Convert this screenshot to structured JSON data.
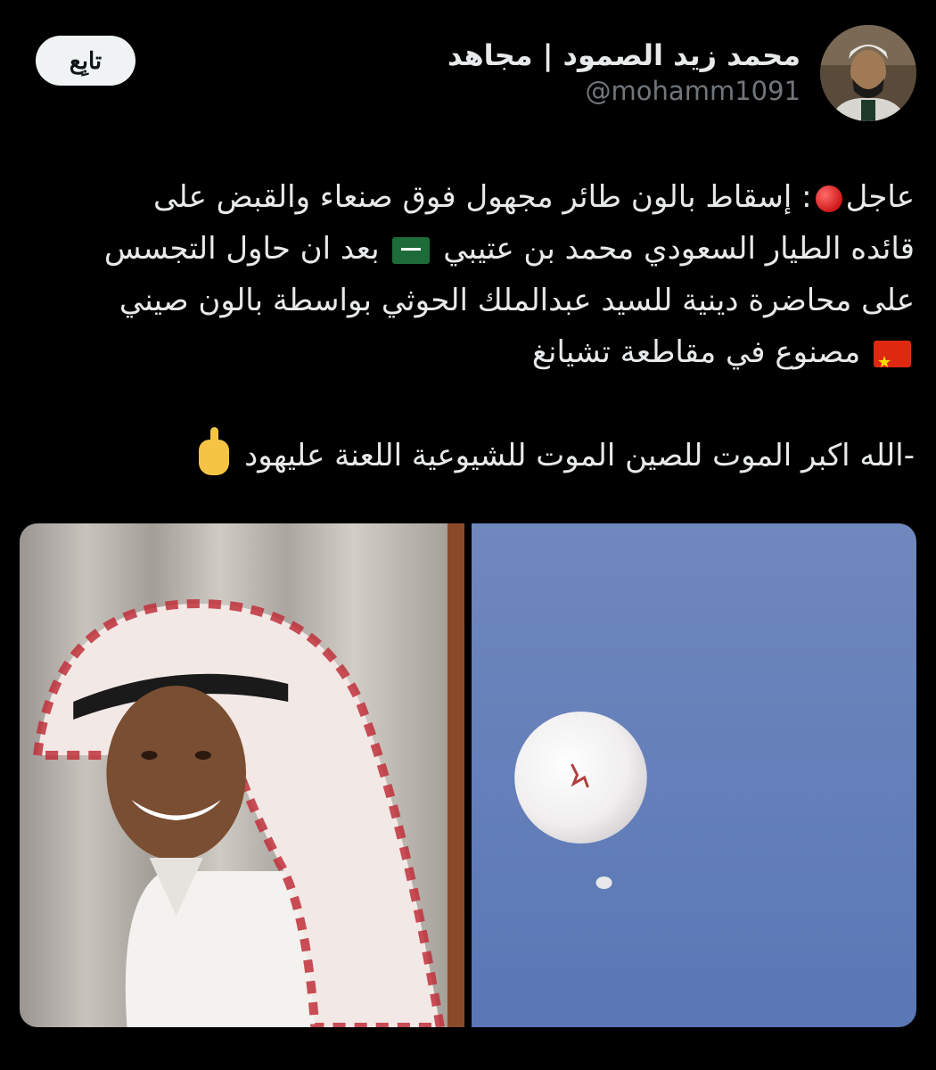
{
  "author": {
    "display_name": "محمد زيد الصمود | مجاهد",
    "handle": "@mohamm1091"
  },
  "follow_button": {
    "label": "تابِع"
  },
  "tweet": {
    "line1_before_icon": "عاجل",
    "line1_after_icon": ": إسقاط بالون طائر مجهول فوق صنعاء والقبض على",
    "line2_before_flag": "قائده الطيار السعودي محمد بن عتيبي",
    "line2_after_flag": "بعد ان حاول التجسس",
    "line3": "على محاضرة دينية للسيد عبدالملك الحوثي بواسطة بالون صيني",
    "line4_before_flag": "مصنوع في مقاطعة تشيانغ",
    "line5": "-الله اكبر الموت للصين الموت للشيوعية اللعنة عليهود"
  },
  "icons": {
    "red_circle": "red-circle-icon",
    "saudi_flag": "saudi-flag-icon",
    "china_flag": "china-flag-icon",
    "pointing_up": "index-pointing-up-icon"
  },
  "colors": {
    "background": "#000000",
    "text": "#e7e9ea",
    "secondary_text": "#71767b",
    "follow_button_bg": "#eff3f4"
  }
}
